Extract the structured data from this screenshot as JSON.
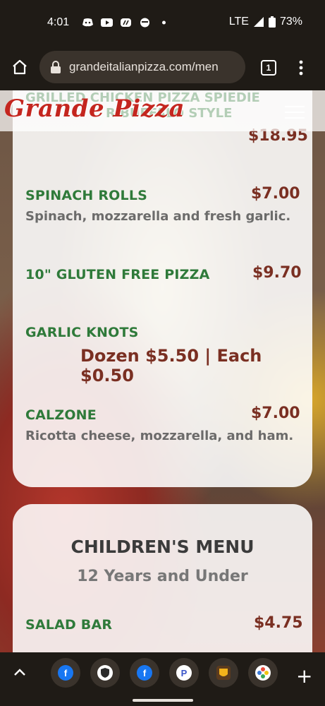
{
  "status_bar": {
    "time": "4:01",
    "network": "LTE",
    "battery": "73%"
  },
  "browser": {
    "url": "grandeitalianpizza.com/men",
    "tab_count": "1"
  },
  "site_header": {
    "logo_text": "Grande Pizza",
    "ghost_line_1": "GRILLED CHICKEN PIZZA SPIEDIE",
    "ghost_line_2": "R BUFFALO STYLE"
  },
  "menu": {
    "prev_price": "$18.95",
    "items": [
      {
        "name": "SPINACH ROLLS",
        "price": "$7.00",
        "desc": "Spinach, mozzarella and fresh garlic."
      },
      {
        "name": "10\" GLUTEN FREE PIZZA",
        "price": "$9.70",
        "desc": ""
      },
      {
        "name": "GARLIC KNOTS",
        "price": "Dozen $5.50 | Each $0.50",
        "desc": ""
      },
      {
        "name": "CALZONE",
        "price": "$7.00",
        "desc": "Ricotta cheese, mozzarella, and ham."
      }
    ]
  },
  "childrens_menu": {
    "title": "CHILDREN'S MENU",
    "subtitle": "12 Years and Under",
    "items": [
      {
        "name": "SALAD BAR",
        "price": "$4.75"
      }
    ]
  },
  "bottom_tabs": [
    {
      "icon": "facebook-icon",
      "label": "f",
      "color": "#1877f2"
    },
    {
      "icon": "shield-icon",
      "label": "",
      "color": "#ffffff"
    },
    {
      "icon": "facebook-icon",
      "label": "f",
      "color": "#1877f2"
    },
    {
      "icon": "p-icon",
      "label": "P",
      "color": "#ffffff"
    },
    {
      "icon": "ups-icon",
      "label": "",
      "color": "#5b3b1f"
    },
    {
      "icon": "flower-icon",
      "label": "",
      "color": "#ffffff"
    }
  ],
  "colors": {
    "item_name": "#2f7a3a",
    "item_price": "#7a2f22",
    "logo": "#c4261f"
  }
}
